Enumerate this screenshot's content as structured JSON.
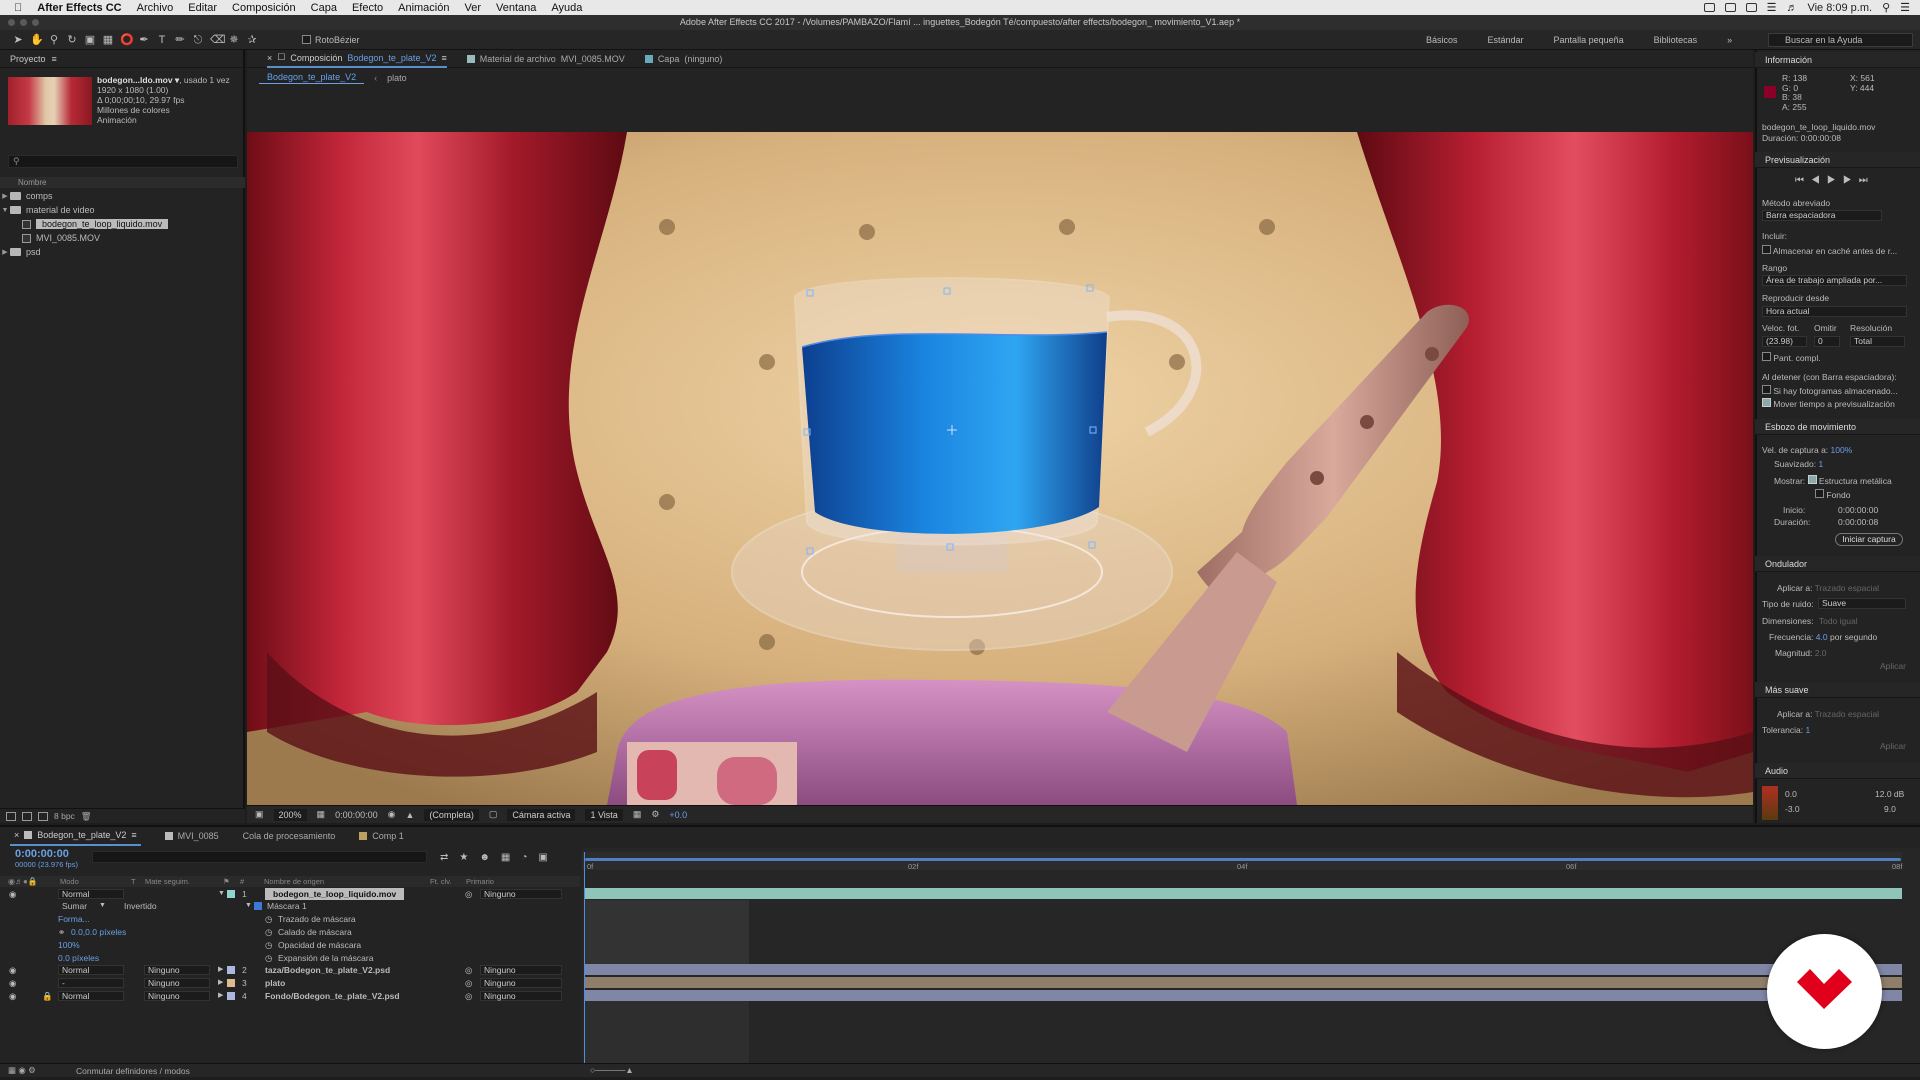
{
  "menubar": {
    "app": "After Effects CC",
    "items": [
      "Archivo",
      "Editar",
      "Composición",
      "Capa",
      "Efecto",
      "Animación",
      "Ver",
      "Ventana",
      "Ayuda"
    ],
    "clock": "Vie 8:09 p.m."
  },
  "titlebar": {
    "title": "Adobe After Effects CC 2017 - /Volumes/PAMBAZO/Flamí ... inguettes_Bodegón Té/compuesto/after effects/bodegon_ movimiento_V1.aep *"
  },
  "toolbar": {
    "rotobezier": "RotoBézier",
    "workspaces": [
      "Básicos",
      "Estándar",
      "Pantalla pequeña",
      "Bibliotecas"
    ],
    "help_placeholder": "Buscar en la Ayuda"
  },
  "project": {
    "title": "Proyecto",
    "file_name": "bodegon...ldo.mov ▾",
    "file_used": ", usado 1 vez",
    "dims": "1920 x 1080 (1.00)",
    "duration": "Δ 0;00;00;10, 29.97 fps",
    "colors": "Millones de colores",
    "kind": "Animación",
    "col_name": "Nombre",
    "tree": [
      "comps",
      "material de video",
      "bodegon_te_loop_liquido.mov",
      "MVI_0085.MOV",
      "psd"
    ],
    "bpc": "8 bpc"
  },
  "comp": {
    "tabs": [
      {
        "prefix": "Composición",
        "name": "Bodegon_te_plate_V2"
      },
      {
        "prefix": "Material de archivo",
        "name": "MVI_0085.MOV"
      },
      {
        "prefix": "Capa",
        "name": "(ninguno)"
      }
    ],
    "breadcrumb": [
      "Bodegon_te_plate_V2",
      "plato"
    ],
    "zoom": "200%",
    "timecode": "0:00:00:00",
    "quality": "(Completa)",
    "camera": "Cámara activa",
    "views": "1 Vista",
    "exposure": "+0.0"
  },
  "info": {
    "title": "Información",
    "r": "R: 138",
    "g": "G: 0",
    "b": "B: 38",
    "a": "A: 255",
    "x": "X: 561",
    "y": "Y: 444",
    "file": "bodegon_te_loop_liquido.mov",
    "dur": "Duración: 0:00:00:08"
  },
  "preview": {
    "title": "Previsualización",
    "shortcut_label": "Método abreviado",
    "shortcut": "Barra espaciadora",
    "include": "Incluir:",
    "cache": "Almacenar en caché antes de r...",
    "range_label": "Rango",
    "range": "Área de trabajo ampliada por...",
    "playfrom_label": "Reproducir desde",
    "playfrom": "Hora actual",
    "fps_label": "Veloc. fot.",
    "skip_label": "Omitir",
    "res_label": "Resolución",
    "fps": "(23.98)",
    "skip": "0",
    "res": "Total",
    "fullscreen": "Pant. compl.",
    "onstop": "Al detener (con Barra espaciadora):",
    "cached": "Si hay fotogramas almacenado...",
    "move": "Mover tiempo a previsualización"
  },
  "motion": {
    "title": "Esbozo de movimiento",
    "speed_label": "Vel. de captura a:",
    "speed": "100",
    "pct": "%",
    "smooth_label": "Suavizado:",
    "smooth": "1",
    "show_label": "Mostrar:",
    "wire": "Estructura metálica",
    "bg": "Fondo",
    "start_label": "Inicio:",
    "start": "0:00:00:00",
    "dur_label": "Duración:",
    "dur": "0:00:00:08",
    "button": "Iniciar captura"
  },
  "wiggler": {
    "title": "Ondulador",
    "apply_label": "Aplicar a:",
    "apply": "Trazado espacial",
    "noise_label": "Tipo de ruido:",
    "noise": "Suave",
    "dim_label": "Dimensiones:",
    "dim": "Todo igual",
    "freq_label": "Frecuencia:",
    "freq": "4.0",
    "freq_unit": "por segundo",
    "mag_label": "Magnitud:",
    "mag": "2.0",
    "button": "Aplicar"
  },
  "smoother": {
    "title": "Más suave",
    "apply_label": "Aplicar a:",
    "apply": "Trazado espacial",
    "tol_label": "Tolerancia:",
    "tol": "1",
    "button": "Aplicar"
  },
  "audio": {
    "title": "Audio",
    "l1": "0.0",
    "l2": "-3.0",
    "r1": "12.0 dB",
    "r2": "9.0"
  },
  "timeline": {
    "tabs": [
      "Bodegon_te_plate_V2",
      "MVI_0085",
      "Cola de procesamiento",
      "Comp 1"
    ],
    "time": "0:00:00:00",
    "fps": "00000 (23.976 fps)",
    "cols": {
      "mode": "Modo",
      "t": "T",
      "matte": "Mate seguim.",
      "num": "#",
      "src": "Nombre de origen",
      "fx": "Ft. clv.",
      "parent": "Primario"
    },
    "ticks": [
      "0f",
      "02f",
      "04f",
      "06f",
      "08f"
    ],
    "layers": [
      {
        "mode": "Normal",
        "num": "1",
        "name": "bodegon_te_loop_liquido.mov",
        "parent": "Ninguno"
      },
      {
        "mode": "Normal",
        "matte": "Ninguno",
        "num": "2",
        "name": "taza/Bodegon_te_plate_V2.psd",
        "parent": "Ninguno"
      },
      {
        "mode": "-",
        "matte": "Ninguno",
        "num": "3",
        "name": "plato",
        "parent": "Ninguno"
      },
      {
        "mode": "Normal",
        "matte": "Ninguno",
        "num": "4",
        "name": "Fondo/Bodegon_te_plate_V2.psd",
        "parent": "Ninguno"
      }
    ],
    "mask": {
      "group": "Máscara 1",
      "add": "Sumar",
      "inverted": "Invertido",
      "shape": "Forma...",
      "path": "Trazado de máscara",
      "feather_label": "Calado de máscara",
      "feather": "0.0,0.0 píxeles",
      "opacity_label": "Opacidad de máscara",
      "opacity": "100%",
      "exp_label": "Expansión de la máscara",
      "exp": "0.0 píxeles"
    },
    "footer": "Conmutar definidores / modos"
  },
  "colors": {
    "accent": "#6aa0e6",
    "curtain": "#b41f2e",
    "liquid": "#1a78d6"
  }
}
